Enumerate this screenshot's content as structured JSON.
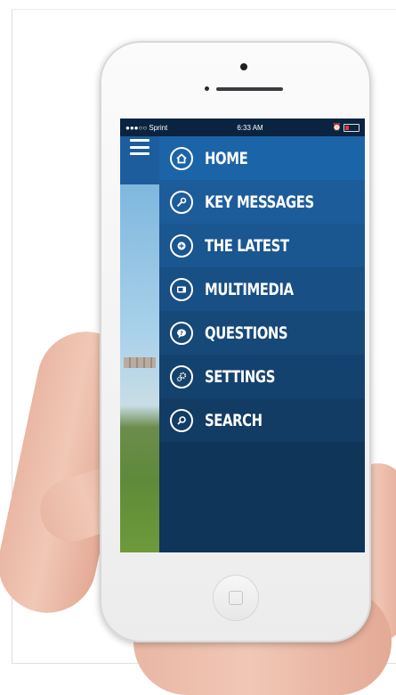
{
  "status_bar": {
    "carrier": "●●●○○ Sprint",
    "time": "6:33 AM"
  },
  "menu": {
    "items": [
      {
        "label": "HOME",
        "icon": "home-icon",
        "color": "#1c64a8"
      },
      {
        "label": "KEY MESSAGES",
        "icon": "key-icon",
        "color": "#1d5c9b"
      },
      {
        "label": "THE LATEST",
        "icon": "news-icon",
        "color": "#1a5690"
      },
      {
        "label": "MULTIMEDIA",
        "icon": "media-icon",
        "color": "#184f84"
      },
      {
        "label": "QUESTIONS",
        "icon": "question-icon",
        "color": "#164878"
      },
      {
        "label": "SETTINGS",
        "icon": "gear-icon",
        "color": "#14426e"
      },
      {
        "label": "SEARCH",
        "icon": "search-icon",
        "color": "#123c64"
      }
    ]
  },
  "colors": {
    "menu_background": "#0f3558",
    "rail": "#1d5d9d"
  }
}
